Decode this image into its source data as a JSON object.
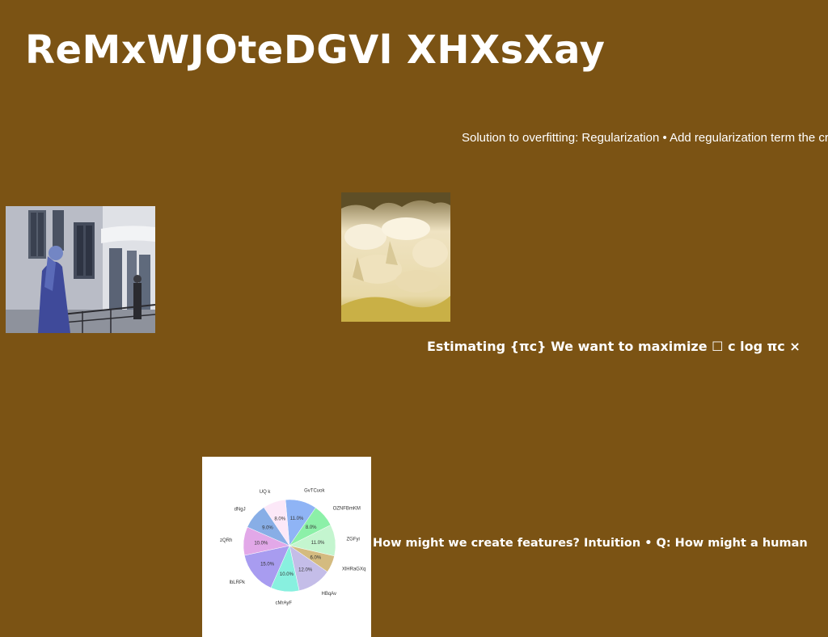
{
  "slide": {
    "title": "ReMxWJOteDGVl XHXsXay",
    "text_regularization": "Solution to overfitting: Regularization • Add regularization term the cross entropy loss function E(w) = − ⌷ n {yn log ⌷(w",
    "text_estimating": "Estimating {πc} We want to maximize ☐ c log πc ×",
    "text_features": "How might we create features? Intuition • Q: How might a human",
    "background_color": "#7b5314"
  },
  "chart_data": {
    "type": "pie",
    "categories": [
      "GvTCuok",
      "OZNFBmKM",
      "ZGFyi",
      "XlHRaGXq",
      "HBqAv",
      "cMrAyF",
      "lbLRPk",
      "zQRh",
      "dNgJ",
      "UQ k"
    ],
    "values": [
      11.0,
      8.0,
      11.0,
      6.0,
      12.0,
      10.0,
      15.0,
      10.0,
      9.0,
      8.0
    ],
    "labels": [
      "11.0%",
      "8.0%",
      "11.0%",
      "6.0%",
      "12.0%",
      "10.0%",
      "15.0%",
      "10.0%",
      "9.0%",
      "8.0%"
    ],
    "colors": [
      "#8fb4f5",
      "#8cf0a8",
      "#c4f5cf",
      "#d4bb80",
      "#c4bde8",
      "#88f0df",
      "#a89cf0",
      "#e2a8e8",
      "#88aee6",
      "#fce8f8"
    ],
    "title": "",
    "legend": "none"
  }
}
